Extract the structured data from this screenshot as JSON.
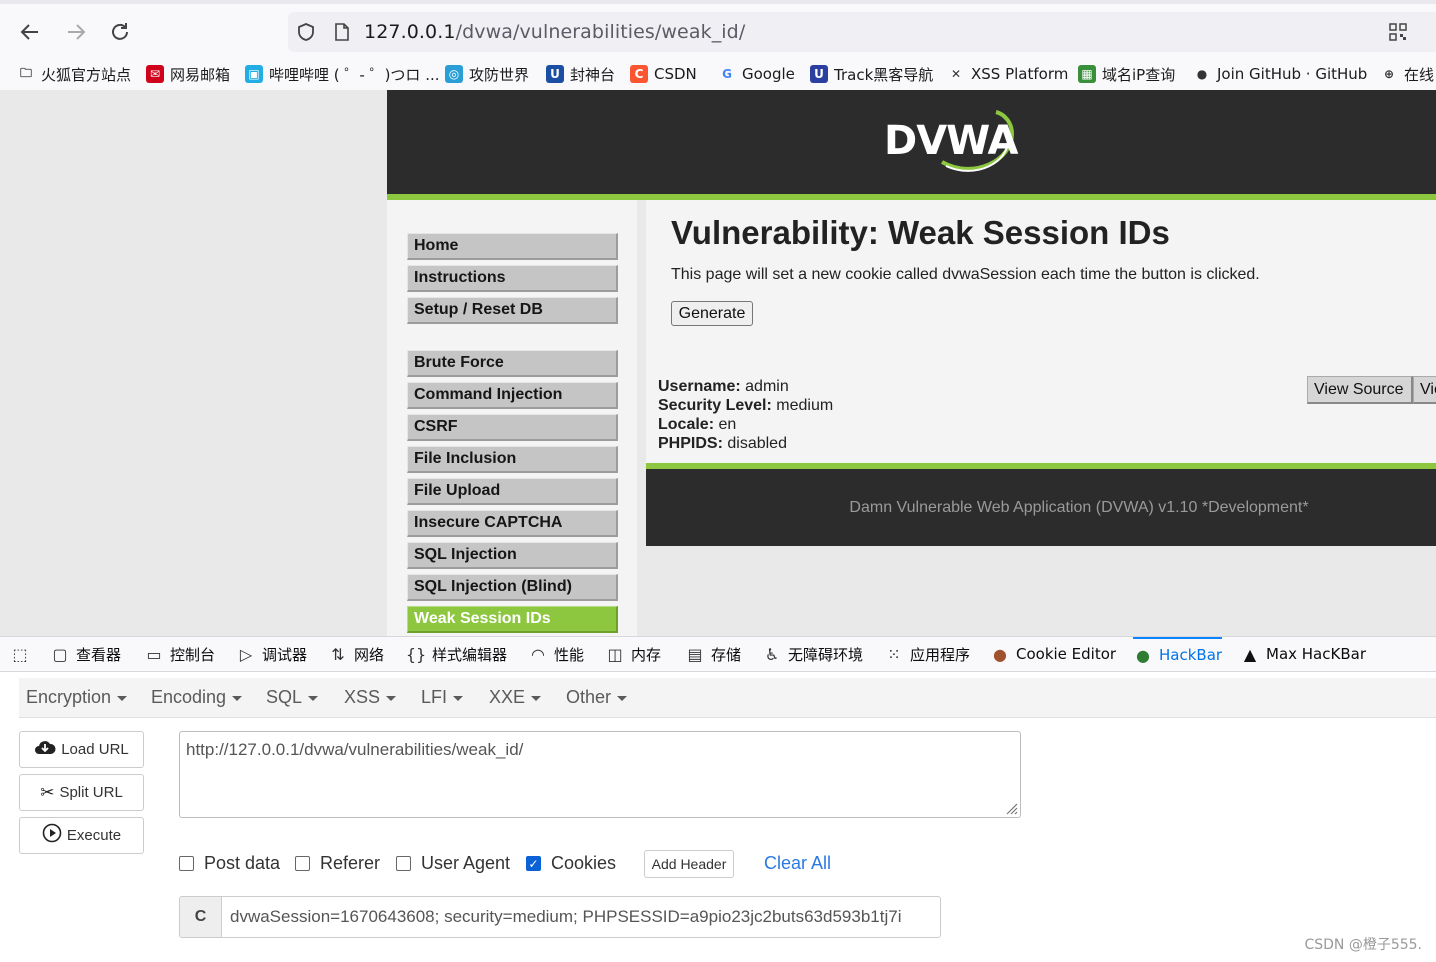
{
  "browser": {
    "url_host": "127.0.0.1",
    "url_path": "/dvwa/vulnerabilities/weak_id/"
  },
  "bookmarks": [
    {
      "label": "火狐官方站点",
      "icon": "folder-icon"
    },
    {
      "label": "网易邮箱",
      "icon": "netease-mail-icon"
    },
    {
      "label": "哔哩哔哩 ( ゜- ゜)つロ ...",
      "icon": "bilibili-icon"
    },
    {
      "label": "攻防世界",
      "icon": "adworld-icon"
    },
    {
      "label": "封神台",
      "icon": "fengshentai-icon"
    },
    {
      "label": "CSDN",
      "icon": "csdn-icon"
    },
    {
      "label": "Google",
      "icon": "google-icon"
    },
    {
      "label": "Track黑客导航",
      "icon": "track-icon"
    },
    {
      "label": "XSS Platform",
      "icon": "xss-icon"
    },
    {
      "label": "域名iP查询",
      "icon": "domain-query-icon"
    },
    {
      "label": "Join GitHub · GitHub",
      "icon": "github-icon"
    },
    {
      "label": "在线",
      "icon": "globe-icon"
    }
  ],
  "dvwa": {
    "logo": "DVWA",
    "menu": [
      "Home",
      "Instructions",
      "Setup / Reset DB",
      "Brute Force",
      "Command Injection",
      "CSRF",
      "File Inclusion",
      "File Upload",
      "Insecure CAPTCHA",
      "SQL Injection",
      "SQL Injection (Blind)",
      "Weak Session IDs"
    ],
    "title": "Vulnerability: Weak Session IDs",
    "description": "This page will set a new cookie called dvwaSession each time the button is clicked.",
    "generate_label": "Generate",
    "info": {
      "username_label": "Username:",
      "username": "admin",
      "security_label": "Security Level:",
      "security": "medium",
      "locale_label": "Locale:",
      "locale": "en",
      "phpids_label": "PHPIDS:",
      "phpids": "disabled"
    },
    "view_source_label": "View Source",
    "view_help_label": "View Help",
    "footer": "Damn Vulnerable Web Application (DVWA) v1.10 *Development*"
  },
  "devtools": {
    "tabs": [
      {
        "label": "",
        "icon": "picker-icon"
      },
      {
        "label": "查看器",
        "icon": "inspector-icon"
      },
      {
        "label": "控制台",
        "icon": "console-icon"
      },
      {
        "label": "调试器",
        "icon": "debugger-icon"
      },
      {
        "label": "网络",
        "icon": "network-icon"
      },
      {
        "label": "样式编辑器",
        "icon": "style-editor-icon"
      },
      {
        "label": "性能",
        "icon": "performance-icon"
      },
      {
        "label": "内存",
        "icon": "memory-icon"
      },
      {
        "label": "存储",
        "icon": "storage-icon"
      },
      {
        "label": "无障碍环境",
        "icon": "accessibility-icon"
      },
      {
        "label": "应用程序",
        "icon": "application-icon"
      },
      {
        "label": "Cookie Editor",
        "icon": "cookie-icon"
      },
      {
        "label": "HackBar",
        "icon": "hackbar-icon"
      },
      {
        "label": "Max HacKBar",
        "icon": "max-hackbar-icon"
      }
    ],
    "active_tab": "HackBar"
  },
  "hackbar": {
    "menus": [
      "Encryption",
      "Encoding",
      "SQL",
      "XSS",
      "LFI",
      "XXE",
      "Other"
    ],
    "load_url": "Load URL",
    "split_url": "Split URL",
    "execute": "Execute",
    "url_value": "http://127.0.0.1/dvwa/vulnerabilities/weak_id/",
    "options": [
      {
        "label": "Post data",
        "checked": false
      },
      {
        "label": "Referer",
        "checked": false
      },
      {
        "label": "User Agent",
        "checked": false
      },
      {
        "label": "Cookies",
        "checked": true
      }
    ],
    "add_header": "Add Header",
    "clear_all": "Clear All",
    "cookie_label": "C",
    "cookie_value": "dvwaSession=1670643608; security=medium; PHPSESSID=a9pio23jc2buts63d593b1tj7i"
  },
  "watermark": "CSDN @橙子555."
}
